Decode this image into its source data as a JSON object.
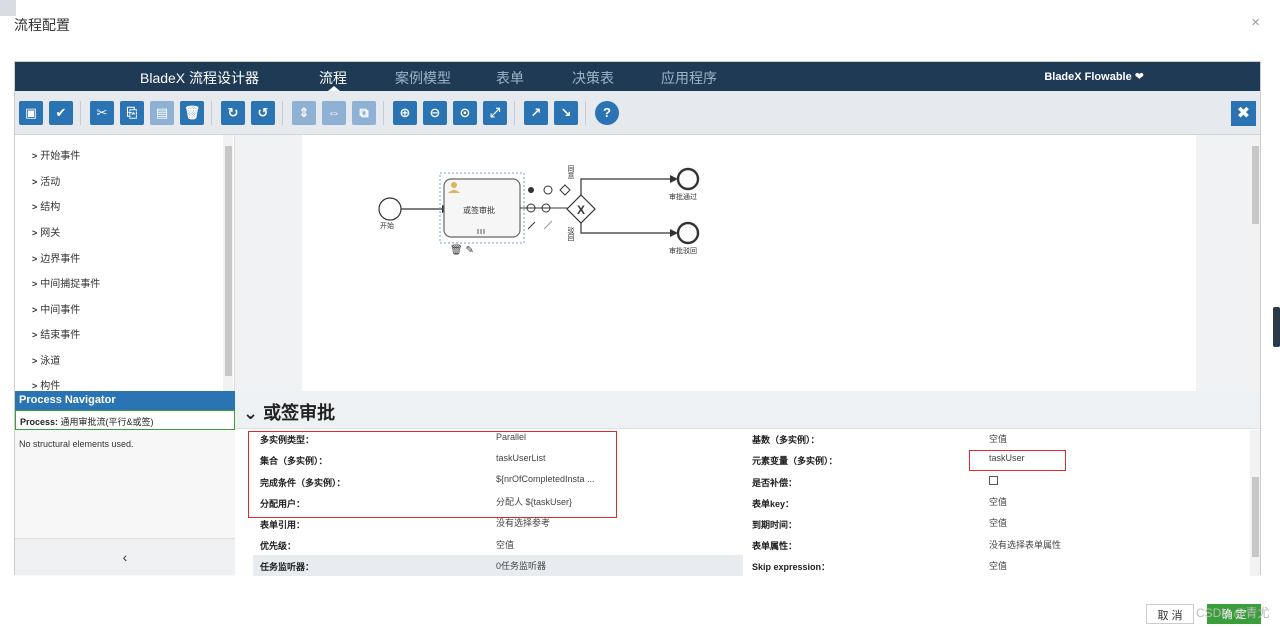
{
  "dialog": {
    "title": "流程配置",
    "close_label": "×"
  },
  "topnav": {
    "brand": "BladeX 流程设计器",
    "tabs": [
      {
        "label": "流程",
        "active": true
      },
      {
        "label": "案例模型",
        "active": false
      },
      {
        "label": "表单",
        "active": false
      },
      {
        "label": "决策表",
        "active": false
      },
      {
        "label": "应用程序",
        "active": false
      }
    ],
    "user_menu": "BladeX Flowable ❤"
  },
  "toolbar": {
    "buttons": [
      {
        "name": "save-icon",
        "glyph": "▣"
      },
      {
        "name": "validate-check-icon",
        "glyph": "✔"
      },
      {
        "name": "cut-icon",
        "glyph": "✂"
      },
      {
        "name": "copy-icon",
        "glyph": "⎘"
      },
      {
        "name": "paste-icon",
        "glyph": "▤"
      },
      {
        "name": "delete-icon",
        "glyph": "🗑"
      },
      {
        "name": "redo-icon",
        "glyph": "↻"
      },
      {
        "name": "undo-icon",
        "glyph": "↺"
      },
      {
        "name": "align-vertical-icon",
        "glyph": "⇕"
      },
      {
        "name": "align-horizontal-icon",
        "glyph": "⇔"
      },
      {
        "name": "same-size-icon",
        "glyph": "⧉"
      },
      {
        "name": "zoom-in-icon",
        "glyph": "⊕"
      },
      {
        "name": "zoom-out-icon",
        "glyph": "⊖"
      },
      {
        "name": "zoom-actual-icon",
        "glyph": "⊙"
      },
      {
        "name": "zoom-fit-icon",
        "glyph": "⤢"
      },
      {
        "name": "bendpoint-add-icon",
        "glyph": "↗"
      },
      {
        "name": "bendpoint-remove-icon",
        "glyph": "↘"
      },
      {
        "name": "help-icon",
        "glyph": "?"
      }
    ],
    "close_glyph": "✖"
  },
  "palette": {
    "items": [
      "开始事件",
      "活动",
      "结构",
      "网关",
      "边界事件",
      "中间捕捉事件",
      "中间事件",
      "结束事件",
      "泳道",
      "构件"
    ]
  },
  "navigator": {
    "title": "Process Navigator",
    "process_label": "Process:",
    "process_name": "通用审批流(平行&或签)",
    "empty_text": "No structural elements used.",
    "collapse_glyph": "‹"
  },
  "diagram": {
    "start_label": "开始",
    "task_label": "或签审批",
    "end_pass_label": "审批通过",
    "end_reject_label": "审批驳回",
    "flow_pass_label": "同意",
    "flow_reject_label": "驳回"
  },
  "properties": {
    "title": "或签审批",
    "rows": [
      {
        "label": "多实例类型：",
        "value": "Parallel"
      },
      {
        "label": "集合（多实例）：",
        "value": "taskUserList"
      },
      {
        "label": "完成条件（多实例）：",
        "value": "${nrOfCompletedInsta ..."
      },
      {
        "label": "分配用户：",
        "value": "分配人 ${taskUser}"
      },
      {
        "label": "表单引用：",
        "value": "没有选择参考"
      },
      {
        "label": "优先级：",
        "value": "空值"
      },
      {
        "label": "任务监听器：",
        "value": "0任务监听器"
      }
    ],
    "rows_right": [
      {
        "label": "基数（多实例）：",
        "value": "空值"
      },
      {
        "label": "元素变量（多实例）：",
        "value": "taskUser"
      },
      {
        "label": "是否补偿：",
        "value": ""
      },
      {
        "label": "表单key：",
        "value": "空值"
      },
      {
        "label": "到期时间：",
        "value": "空值"
      },
      {
        "label": "表单属性：",
        "value": "没有选择表单属性"
      },
      {
        "label": "Skip expression：",
        "value": "空值"
      }
    ]
  },
  "footer": {
    "cancel_label": "取 消",
    "ok_label": "确 定",
    "watermark": "CSDN @青尤"
  },
  "colors": {
    "nav_bg": "#1f3a55",
    "button_blue": "#2a74b4",
    "highlight_red": "#e02b2b",
    "ok_green": "#3a9f3a"
  }
}
